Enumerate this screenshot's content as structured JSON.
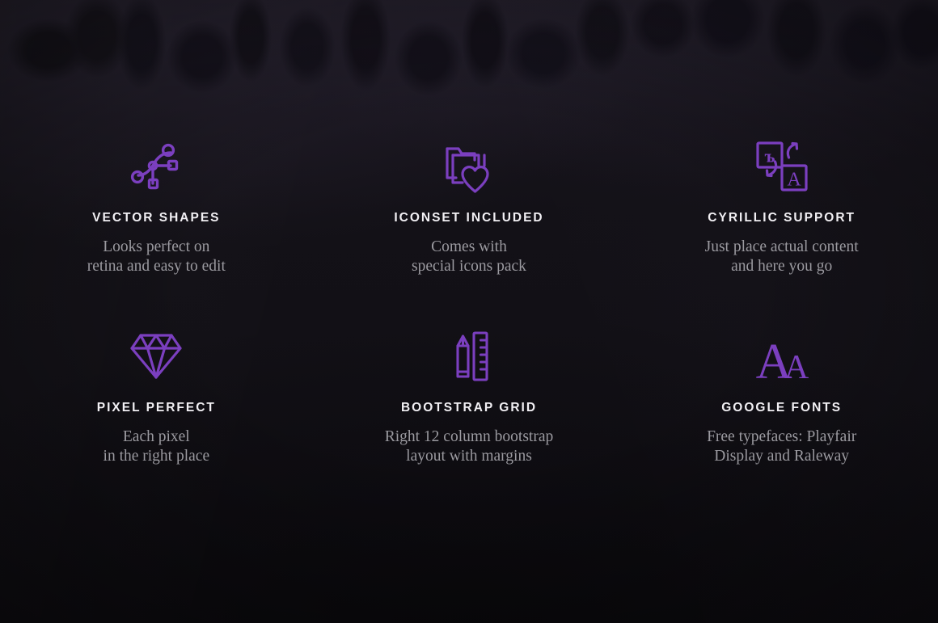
{
  "theme": {
    "background_color": "#131117",
    "accent_color": "#7b3fbf",
    "heading_color": "#f2f0f4",
    "body_text_color": "#9b9aa0"
  },
  "features": [
    {
      "icon": "vector-shapes-icon",
      "title": "VECTOR SHAPES",
      "description": "Looks perfect on\nretina and easy to edit"
    },
    {
      "icon": "iconset-folder-heart-icon",
      "title": "ICONSET INCLUDED",
      "description": "Comes with\nspecial icons pack"
    },
    {
      "icon": "cyrillic-support-icon",
      "title": "CYRILLIC SUPPORT",
      "description": "Just place actual content\nand here you go"
    },
    {
      "icon": "diamond-icon",
      "title": "PIXEL PERFECT",
      "description": "Each pixel\nin the right place"
    },
    {
      "icon": "pencil-ruler-icon",
      "title": "BOOTSTRAP GRID",
      "description": "Right 12 column bootstrap\nlayout with margins"
    },
    {
      "icon": "google-fonts-letters-icon",
      "title": "GOOGLE FONTS",
      "description": "Free typefaces: Playfair\nDisplay and Raleway"
    }
  ],
  "icon_glyphs": {
    "cyrillic_letter": "ъ",
    "latin_letter": "A",
    "fonts_large_letter": "A",
    "fonts_small_letter": "A"
  }
}
